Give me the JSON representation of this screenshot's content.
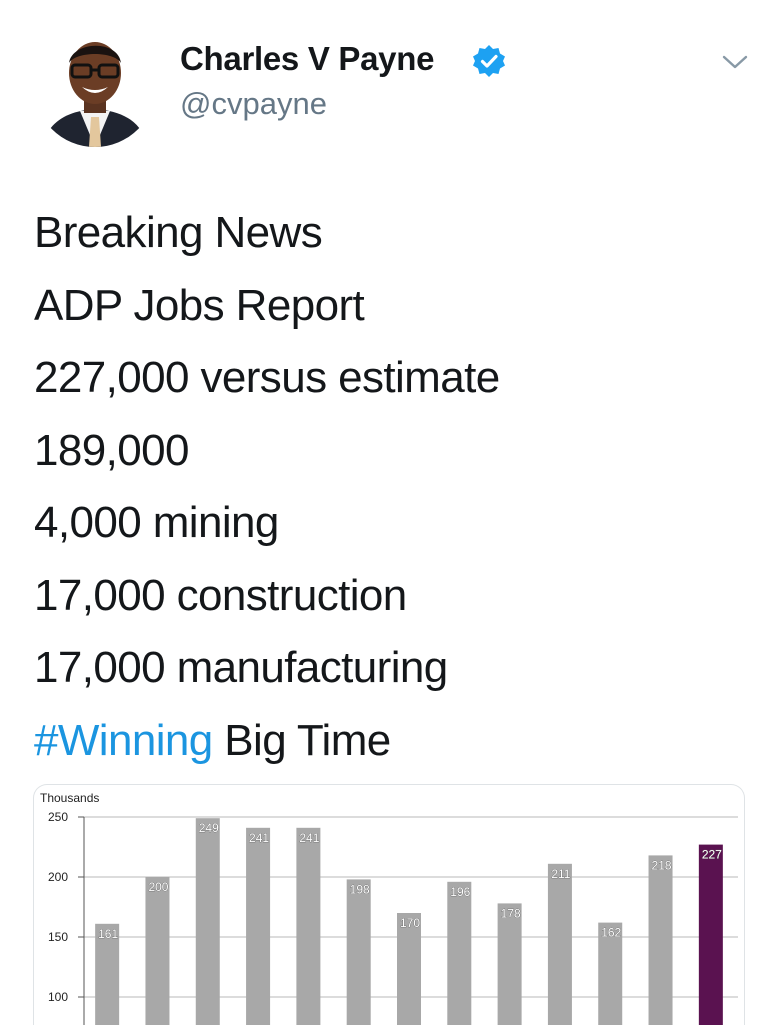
{
  "tweet": {
    "author_name": "Charles V Payne",
    "author_handle": "@cvpayne",
    "verified": true,
    "icons": [
      "verified-badge-icon",
      "chevron-down-icon"
    ],
    "accent_color": "#1b95e0",
    "lines": [
      "Breaking News",
      "ADP Jobs Report",
      "227,000 versus estimate",
      "189,000",
      "4,000 mining",
      "17,000 construction",
      "17,000 manufacturing"
    ],
    "last_line": {
      "hashtag": "#Winning",
      "rest": " Big Time"
    }
  },
  "chart_data": {
    "type": "bar",
    "ylabel": "Thousands",
    "ylim": [
      100,
      250
    ],
    "yticks": [
      "250",
      "200",
      "150",
      "100"
    ],
    "values": [
      161,
      200,
      249,
      241,
      241,
      198,
      170,
      196,
      178,
      211,
      162,
      218,
      227
    ],
    "value_labels": [
      "161",
      "200",
      "249",
      "241",
      "241",
      "198",
      "170",
      "196",
      "178",
      "211",
      "162",
      "218",
      "227"
    ],
    "bar_color": "#a8a8a8",
    "highlight_color": "#5a1250",
    "highlight_index": 12,
    "grid": true
  }
}
